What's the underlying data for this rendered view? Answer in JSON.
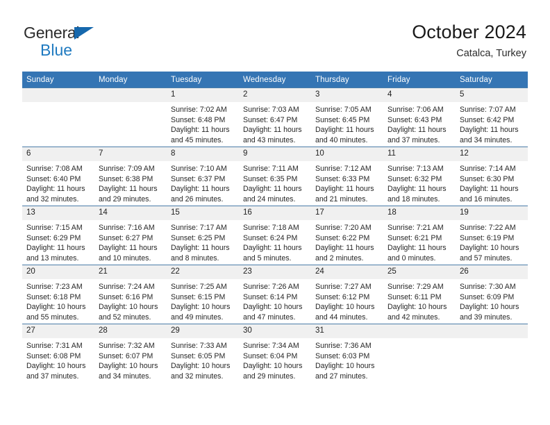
{
  "logo": {
    "text_top": "General",
    "text_bottom": "Blue",
    "triangle_color": "#1668ad",
    "blue_color": "#1f7ac0"
  },
  "header": {
    "title": "October 2024",
    "subtitle": "Catalca, Turkey"
  },
  "theme": {
    "header_row_bg": "#3575b4",
    "header_row_text": "#ffffff",
    "daynum_bg": "#f0f0f0",
    "row_separator": "#4a7ca8"
  },
  "weekdays": [
    "Sunday",
    "Monday",
    "Tuesday",
    "Wednesday",
    "Thursday",
    "Friday",
    "Saturday"
  ],
  "weeks": [
    [
      {
        "day": "",
        "sunrise": "",
        "sunset": "",
        "daylight1": "",
        "daylight2": ""
      },
      {
        "day": "",
        "sunrise": "",
        "sunset": "",
        "daylight1": "",
        "daylight2": ""
      },
      {
        "day": "1",
        "sunrise": "Sunrise: 7:02 AM",
        "sunset": "Sunset: 6:48 PM",
        "daylight1": "Daylight: 11 hours",
        "daylight2": "and 45 minutes."
      },
      {
        "day": "2",
        "sunrise": "Sunrise: 7:03 AM",
        "sunset": "Sunset: 6:47 PM",
        "daylight1": "Daylight: 11 hours",
        "daylight2": "and 43 minutes."
      },
      {
        "day": "3",
        "sunrise": "Sunrise: 7:05 AM",
        "sunset": "Sunset: 6:45 PM",
        "daylight1": "Daylight: 11 hours",
        "daylight2": "and 40 minutes."
      },
      {
        "day": "4",
        "sunrise": "Sunrise: 7:06 AM",
        "sunset": "Sunset: 6:43 PM",
        "daylight1": "Daylight: 11 hours",
        "daylight2": "and 37 minutes."
      },
      {
        "day": "5",
        "sunrise": "Sunrise: 7:07 AM",
        "sunset": "Sunset: 6:42 PM",
        "daylight1": "Daylight: 11 hours",
        "daylight2": "and 34 minutes."
      }
    ],
    [
      {
        "day": "6",
        "sunrise": "Sunrise: 7:08 AM",
        "sunset": "Sunset: 6:40 PM",
        "daylight1": "Daylight: 11 hours",
        "daylight2": "and 32 minutes."
      },
      {
        "day": "7",
        "sunrise": "Sunrise: 7:09 AM",
        "sunset": "Sunset: 6:38 PM",
        "daylight1": "Daylight: 11 hours",
        "daylight2": "and 29 minutes."
      },
      {
        "day": "8",
        "sunrise": "Sunrise: 7:10 AM",
        "sunset": "Sunset: 6:37 PM",
        "daylight1": "Daylight: 11 hours",
        "daylight2": "and 26 minutes."
      },
      {
        "day": "9",
        "sunrise": "Sunrise: 7:11 AM",
        "sunset": "Sunset: 6:35 PM",
        "daylight1": "Daylight: 11 hours",
        "daylight2": "and 24 minutes."
      },
      {
        "day": "10",
        "sunrise": "Sunrise: 7:12 AM",
        "sunset": "Sunset: 6:33 PM",
        "daylight1": "Daylight: 11 hours",
        "daylight2": "and 21 minutes."
      },
      {
        "day": "11",
        "sunrise": "Sunrise: 7:13 AM",
        "sunset": "Sunset: 6:32 PM",
        "daylight1": "Daylight: 11 hours",
        "daylight2": "and 18 minutes."
      },
      {
        "day": "12",
        "sunrise": "Sunrise: 7:14 AM",
        "sunset": "Sunset: 6:30 PM",
        "daylight1": "Daylight: 11 hours",
        "daylight2": "and 16 minutes."
      }
    ],
    [
      {
        "day": "13",
        "sunrise": "Sunrise: 7:15 AM",
        "sunset": "Sunset: 6:29 PM",
        "daylight1": "Daylight: 11 hours",
        "daylight2": "and 13 minutes."
      },
      {
        "day": "14",
        "sunrise": "Sunrise: 7:16 AM",
        "sunset": "Sunset: 6:27 PM",
        "daylight1": "Daylight: 11 hours",
        "daylight2": "and 10 minutes."
      },
      {
        "day": "15",
        "sunrise": "Sunrise: 7:17 AM",
        "sunset": "Sunset: 6:25 PM",
        "daylight1": "Daylight: 11 hours",
        "daylight2": "and 8 minutes."
      },
      {
        "day": "16",
        "sunrise": "Sunrise: 7:18 AM",
        "sunset": "Sunset: 6:24 PM",
        "daylight1": "Daylight: 11 hours",
        "daylight2": "and 5 minutes."
      },
      {
        "day": "17",
        "sunrise": "Sunrise: 7:20 AM",
        "sunset": "Sunset: 6:22 PM",
        "daylight1": "Daylight: 11 hours",
        "daylight2": "and 2 minutes."
      },
      {
        "day": "18",
        "sunrise": "Sunrise: 7:21 AM",
        "sunset": "Sunset: 6:21 PM",
        "daylight1": "Daylight: 11 hours",
        "daylight2": "and 0 minutes."
      },
      {
        "day": "19",
        "sunrise": "Sunrise: 7:22 AM",
        "sunset": "Sunset: 6:19 PM",
        "daylight1": "Daylight: 10 hours",
        "daylight2": "and 57 minutes."
      }
    ],
    [
      {
        "day": "20",
        "sunrise": "Sunrise: 7:23 AM",
        "sunset": "Sunset: 6:18 PM",
        "daylight1": "Daylight: 10 hours",
        "daylight2": "and 55 minutes."
      },
      {
        "day": "21",
        "sunrise": "Sunrise: 7:24 AM",
        "sunset": "Sunset: 6:16 PM",
        "daylight1": "Daylight: 10 hours",
        "daylight2": "and 52 minutes."
      },
      {
        "day": "22",
        "sunrise": "Sunrise: 7:25 AM",
        "sunset": "Sunset: 6:15 PM",
        "daylight1": "Daylight: 10 hours",
        "daylight2": "and 49 minutes."
      },
      {
        "day": "23",
        "sunrise": "Sunrise: 7:26 AM",
        "sunset": "Sunset: 6:14 PM",
        "daylight1": "Daylight: 10 hours",
        "daylight2": "and 47 minutes."
      },
      {
        "day": "24",
        "sunrise": "Sunrise: 7:27 AM",
        "sunset": "Sunset: 6:12 PM",
        "daylight1": "Daylight: 10 hours",
        "daylight2": "and 44 minutes."
      },
      {
        "day": "25",
        "sunrise": "Sunrise: 7:29 AM",
        "sunset": "Sunset: 6:11 PM",
        "daylight1": "Daylight: 10 hours",
        "daylight2": "and 42 minutes."
      },
      {
        "day": "26",
        "sunrise": "Sunrise: 7:30 AM",
        "sunset": "Sunset: 6:09 PM",
        "daylight1": "Daylight: 10 hours",
        "daylight2": "and 39 minutes."
      }
    ],
    [
      {
        "day": "27",
        "sunrise": "Sunrise: 7:31 AM",
        "sunset": "Sunset: 6:08 PM",
        "daylight1": "Daylight: 10 hours",
        "daylight2": "and 37 minutes."
      },
      {
        "day": "28",
        "sunrise": "Sunrise: 7:32 AM",
        "sunset": "Sunset: 6:07 PM",
        "daylight1": "Daylight: 10 hours",
        "daylight2": "and 34 minutes."
      },
      {
        "day": "29",
        "sunrise": "Sunrise: 7:33 AM",
        "sunset": "Sunset: 6:05 PM",
        "daylight1": "Daylight: 10 hours",
        "daylight2": "and 32 minutes."
      },
      {
        "day": "30",
        "sunrise": "Sunrise: 7:34 AM",
        "sunset": "Sunset: 6:04 PM",
        "daylight1": "Daylight: 10 hours",
        "daylight2": "and 29 minutes."
      },
      {
        "day": "31",
        "sunrise": "Sunrise: 7:36 AM",
        "sunset": "Sunset: 6:03 PM",
        "daylight1": "Daylight: 10 hours",
        "daylight2": "and 27 minutes."
      },
      {
        "day": "",
        "sunrise": "",
        "sunset": "",
        "daylight1": "",
        "daylight2": ""
      },
      {
        "day": "",
        "sunrise": "",
        "sunset": "",
        "daylight1": "",
        "daylight2": ""
      }
    ]
  ]
}
